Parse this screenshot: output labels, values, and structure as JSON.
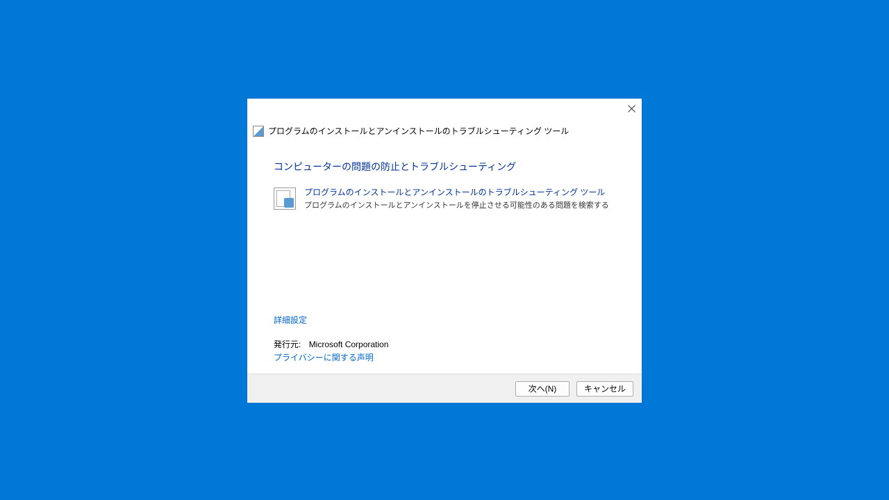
{
  "dialog": {
    "header_title": "プログラムのインストールとアンインストールのトラブルシューティング ツール",
    "main_title": "コンピューターの問題の防止とトラブルシューティング",
    "item": {
      "title": "プログラムのインストールとアンインストールのトラブルシューティング ツール",
      "description": "プログラムのインストールとアンインストールを停止させる可能性のある問題を検索する"
    },
    "advanced_link": "詳細設定",
    "publisher_label": "発行元:",
    "publisher_value": "Microsoft Corporation",
    "privacy_link": "プライバシーに関する声明",
    "buttons": {
      "next": "次へ(N)",
      "cancel": "キャンセル"
    }
  }
}
